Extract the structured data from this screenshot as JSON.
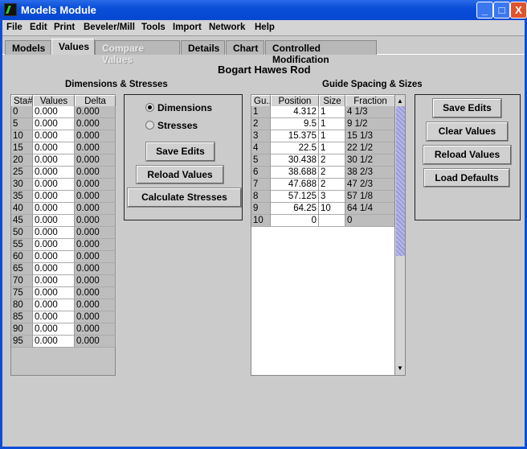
{
  "window": {
    "title": "Models Module",
    "minimize": "_",
    "maximize": "□",
    "close": "X"
  },
  "menu": [
    "File",
    "Edit",
    "Print",
    "Beveler/Mill",
    "Tools",
    "Import",
    "Network",
    "Help"
  ],
  "tabs": [
    {
      "label": "Models"
    },
    {
      "label": "Values",
      "selected": true
    },
    {
      "label": "Compare Values",
      "disabled": true
    },
    {
      "label": "Details"
    },
    {
      "label": "Chart"
    },
    {
      "label": "Controlled Modification"
    }
  ],
  "model_title": "Bogart Hawes Rod",
  "dimensions": {
    "heading": "Dimensions & Stresses",
    "columns": [
      "Sta#",
      "Values",
      "Delta"
    ],
    "rows": [
      [
        "0",
        "0.000",
        "0.000"
      ],
      [
        "5",
        "0.000",
        "0.000"
      ],
      [
        "10",
        "0.000",
        "0.000"
      ],
      [
        "15",
        "0.000",
        "0.000"
      ],
      [
        "20",
        "0.000",
        "0.000"
      ],
      [
        "25",
        "0.000",
        "0.000"
      ],
      [
        "30",
        "0.000",
        "0.000"
      ],
      [
        "35",
        "0.000",
        "0.000"
      ],
      [
        "40",
        "0.000",
        "0.000"
      ],
      [
        "45",
        "0.000",
        "0.000"
      ],
      [
        "50",
        "0.000",
        "0.000"
      ],
      [
        "55",
        "0.000",
        "0.000"
      ],
      [
        "60",
        "0.000",
        "0.000"
      ],
      [
        "65",
        "0.000",
        "0.000"
      ],
      [
        "70",
        "0.000",
        "0.000"
      ],
      [
        "75",
        "0.000",
        "0.000"
      ],
      [
        "80",
        "0.000",
        "0.000"
      ],
      [
        "85",
        "0.000",
        "0.000"
      ],
      [
        "90",
        "0.000",
        "0.000"
      ],
      [
        "95",
        "0.000",
        "0.000"
      ]
    ],
    "radio": {
      "dimensions": "Dimensions",
      "stresses": "Stresses",
      "selected": "Dimensions"
    },
    "buttons": {
      "save": "Save Edits",
      "reload": "Reload Values",
      "calculate": "Calculate Stresses"
    }
  },
  "guides": {
    "heading": "Guide Spacing & Sizes",
    "columns": [
      "Gu...",
      "Position",
      "Size",
      "Fraction"
    ],
    "rows": [
      [
        "1",
        "4.312",
        "1",
        "4 1/3"
      ],
      [
        "2",
        "9.5",
        "1",
        "9 1/2"
      ],
      [
        "3",
        "15.375",
        "1",
        "15 1/3"
      ],
      [
        "4",
        "22.5",
        "1",
        "22 1/2"
      ],
      [
        "5",
        "30.438",
        "2",
        "30 1/2"
      ],
      [
        "6",
        "38.688",
        "2",
        "38 2/3"
      ],
      [
        "7",
        "47.688",
        "2",
        "47 2/3"
      ],
      [
        "8",
        "57.125",
        "3",
        "57 1/8"
      ],
      [
        "9",
        "64.25",
        "10",
        "64 1/4"
      ],
      [
        "10",
        "0",
        "",
        "0"
      ]
    ],
    "buttons": {
      "save": "Save Edits",
      "clear": "Clear Values",
      "reload": "Reload Values",
      "defaults": "Load Defaults"
    }
  }
}
